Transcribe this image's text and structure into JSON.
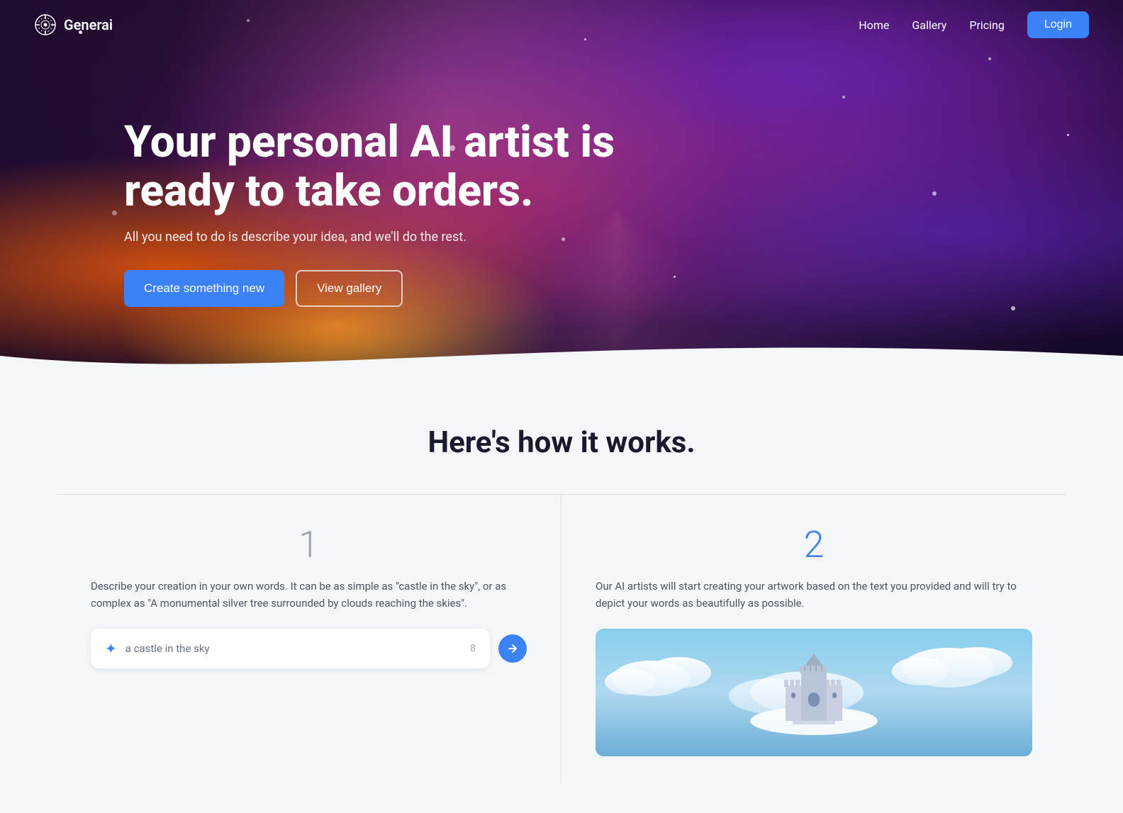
{
  "brand": {
    "name": "Generai",
    "logo_alt": "Generai logo"
  },
  "navbar": {
    "home": "Home",
    "gallery": "Gallery",
    "pricing": "Pricing",
    "login": "Login"
  },
  "hero": {
    "title": "Your personal AI artist is ready to take orders.",
    "subtitle": "All you need to do is describe your idea, and we'll do the rest.",
    "cta_primary": "Create something new",
    "cta_secondary": "View gallery"
  },
  "how_it_works": {
    "section_title": "Here's how it works.",
    "steps": [
      {
        "number": "1",
        "number_color": "gray",
        "description": "Describe your creation in your own words. It can be as simple as \"castle in the sky\", or as complex as \"A monumental silver tree surrounded by clouds reaching the skies\".",
        "input_placeholder": "a castle in the sky",
        "input_count": "8"
      },
      {
        "number": "2",
        "number_color": "blue",
        "description": "Our AI artists will start creating your artwork based on the text you provided and will try to depict your words as beautifully as possible.",
        "has_image": true
      }
    ]
  }
}
